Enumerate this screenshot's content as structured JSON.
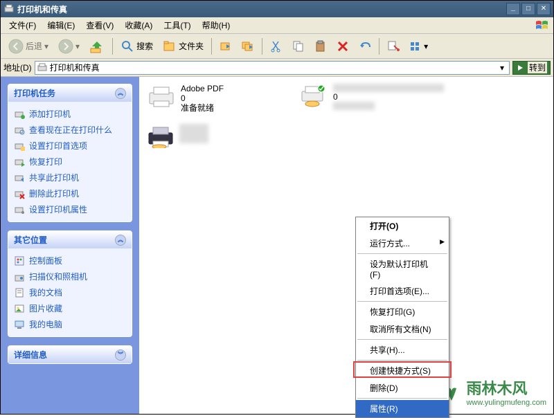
{
  "title": "打印机和传真",
  "winbtns": {
    "min": "_",
    "max": "□",
    "close": "✕"
  },
  "menu": {
    "file": "文件(F)",
    "edit": "编辑(E)",
    "view": "查看(V)",
    "fav": "收藏(A)",
    "tools": "工具(T)",
    "help": "帮助(H)"
  },
  "toolbar": {
    "back": "后退",
    "search": "搜索",
    "folders": "文件夹"
  },
  "addr": {
    "label": "地址(D)",
    "value": "打印机和传真",
    "go": "转到"
  },
  "panel_tasks": {
    "title": "打印机任务",
    "items": [
      "添加打印机",
      "查看现在正在打印什么",
      "设置打印首选项",
      "恢复打印",
      "共享此打印机",
      "删除此打印机",
      "设置打印机属性"
    ]
  },
  "panel_other": {
    "title": "其它位置",
    "items": [
      "控制面板",
      "扫描仪和照相机",
      "我的文档",
      "图片收藏",
      "我的电脑"
    ]
  },
  "panel_detail": {
    "title": "详细信息"
  },
  "printers": {
    "p1": {
      "name": "Adobe PDF",
      "count": "0",
      "status": "准备就绪"
    },
    "p2": {
      "name": "",
      "count": "0",
      "status": ""
    },
    "p3": {
      "name": ""
    }
  },
  "ctx": {
    "open": "打开(O)",
    "runas": "运行方式...",
    "setdef": "设为默认打印机(F)",
    "pref": "打印首选项(E)...",
    "resume": "恢复打印(G)",
    "cancel": "取消所有文档(N)",
    "share": "共享(H)...",
    "shortcut": "创建快捷方式(S)",
    "delete": "删除(D)",
    "props": "属性(R)"
  },
  "watermark": {
    "text": "雨林木风",
    "sub": "www.yulingmufeng.com"
  }
}
